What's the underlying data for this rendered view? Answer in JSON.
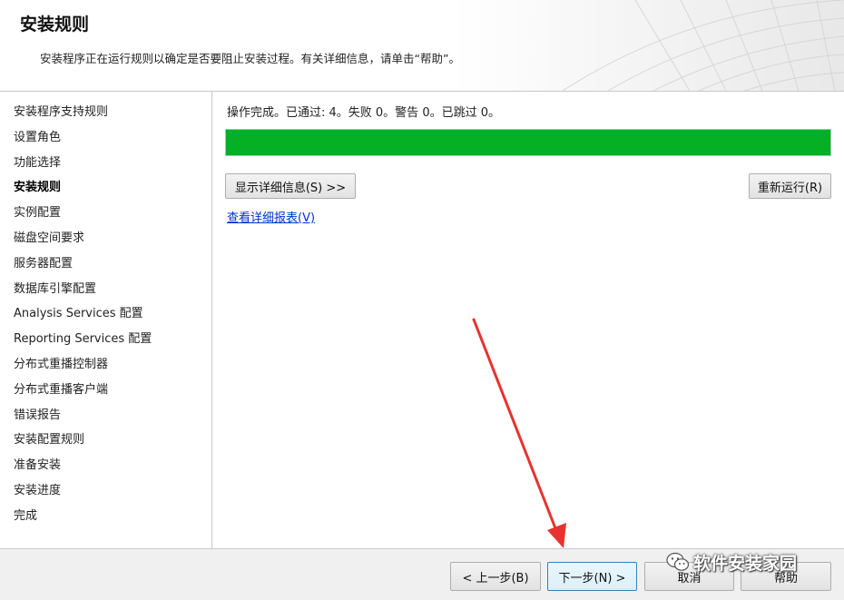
{
  "header": {
    "title": "安装规则",
    "description": "安装程序正在运行规则以确定是否要阻止安装过程。有关详细信息，请单击“帮助”。"
  },
  "sidebar": {
    "items": [
      {
        "label": "安装程序支持规则",
        "active": false
      },
      {
        "label": "设置角色",
        "active": false
      },
      {
        "label": "功能选择",
        "active": false
      },
      {
        "label": "安装规则",
        "active": true
      },
      {
        "label": "实例配置",
        "active": false
      },
      {
        "label": "磁盘空间要求",
        "active": false
      },
      {
        "label": "服务器配置",
        "active": false
      },
      {
        "label": "数据库引擎配置",
        "active": false
      },
      {
        "label": "Analysis Services 配置",
        "active": false
      },
      {
        "label": "Reporting Services 配置",
        "active": false
      },
      {
        "label": "分布式重播控制器",
        "active": false
      },
      {
        "label": "分布式重播客户端",
        "active": false
      },
      {
        "label": "错误报告",
        "active": false
      },
      {
        "label": "安装配置规则",
        "active": false
      },
      {
        "label": "准备安装",
        "active": false
      },
      {
        "label": "安装进度",
        "active": false
      },
      {
        "label": "完成",
        "active": false
      }
    ]
  },
  "main": {
    "status": "操作完成。已通过: 4。失败 0。警告 0。已跳过 0。",
    "progress": 1.0,
    "progress_color": "#06b025",
    "show_details_label": "显示详细信息(S) >>",
    "rerun_label": "重新运行(R)",
    "report_link": "查看详细报表(V)"
  },
  "footer": {
    "prev_label": "< 上一步(B)",
    "next_label": "下一步(N) >",
    "cancel_label": "取消",
    "help_label": "帮助"
  },
  "annotation": {
    "arrow_color": "#e8322e"
  },
  "watermark": {
    "text": "软件安装家园",
    "icon": "wechat-icon"
  }
}
